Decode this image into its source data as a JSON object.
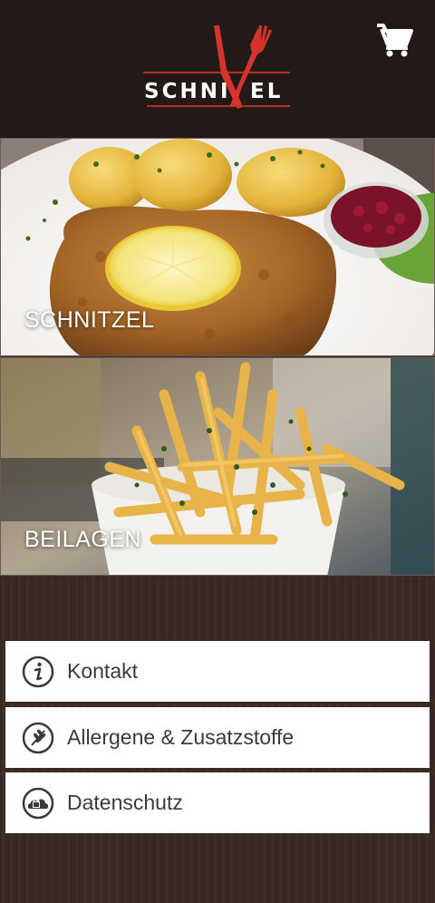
{
  "header": {
    "logo_text": "SCHNITZEL",
    "logo_left": "SCHNI",
    "logo_right": "EL",
    "cart_icon": "cart-icon",
    "accent": "#d6342b"
  },
  "categories": [
    {
      "label": "SCHNITZEL",
      "image": "schnitzel-photo"
    },
    {
      "label": "BEILAGEN",
      "image": "fries-photo"
    }
  ],
  "menu": [
    {
      "label": "Kontakt",
      "icon": "info-icon"
    },
    {
      "label": "Allergene & Zusatzstoffe",
      "icon": "wheat-icon"
    },
    {
      "label": "Datenschutz",
      "icon": "lock-cloud-icon"
    }
  ],
  "colors": {
    "header_bg": "#231a17",
    "page_bg": "#3b2a24",
    "button_bg": "#ffffff",
    "button_text": "#3a3a3a"
  }
}
